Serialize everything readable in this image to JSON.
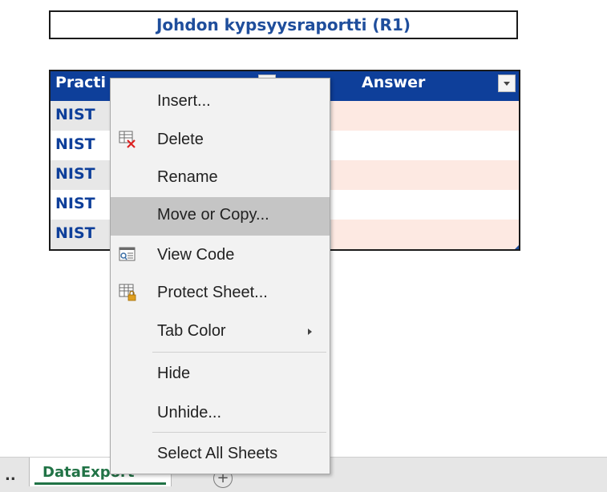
{
  "title": "Johdon kypsyysraportti (R1)",
  "table": {
    "headers": [
      "Practi",
      "Answer"
    ],
    "rows": [
      {
        "practice": "NIST",
        "answer": ""
      },
      {
        "practice": "NIST",
        "answer": ""
      },
      {
        "practice": "NIST",
        "answer": ""
      },
      {
        "practice": "NIST",
        "answer": ""
      },
      {
        "practice": "NIST",
        "answer": ""
      }
    ],
    "colors": {
      "header_bg": "#0e3f9a",
      "header_text": "#ffffff",
      "cell_text": "#0e3f9a",
      "odd_row_a": "#e7e7e7",
      "odd_row_b": "#fde9e2"
    }
  },
  "context_menu": {
    "items": [
      {
        "label": "Insert...",
        "icon": null
      },
      {
        "label": "Delete",
        "icon": "delete-sheet-icon"
      },
      {
        "label": "Rename",
        "icon": null
      },
      {
        "label": "Move or Copy...",
        "icon": null,
        "highlighted": true
      },
      {
        "label": "View Code",
        "icon": "view-code-icon"
      },
      {
        "label": "Protect Sheet...",
        "icon": "protect-sheet-icon"
      },
      {
        "label": "Tab Color",
        "icon": null,
        "submenu": true
      },
      {
        "label": "Hide",
        "icon": null
      },
      {
        "label": "Unhide...",
        "icon": null
      },
      {
        "label": "Select All Sheets",
        "icon": null
      }
    ]
  },
  "tabbar": {
    "ellipsis": "..",
    "active_tab": "DataExport",
    "add_sheet": "+",
    "accent": "#217346"
  }
}
